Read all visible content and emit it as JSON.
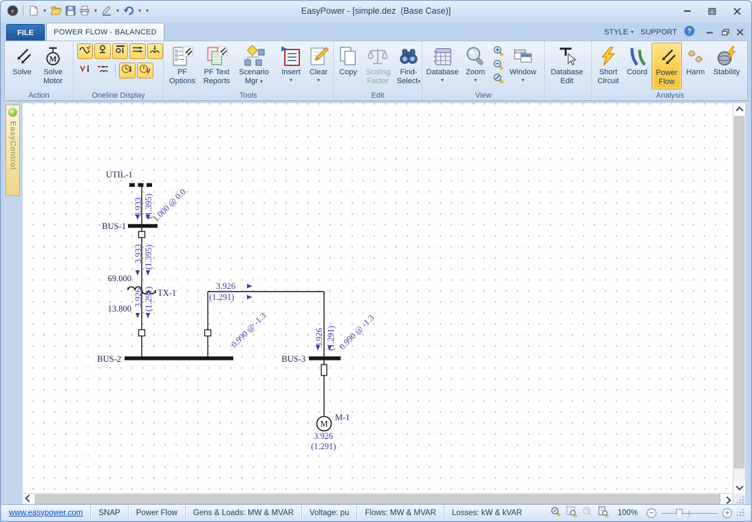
{
  "window": {
    "title": "EasyPower - [simple.dez  (Base Case)]",
    "style_menu": "STYLE",
    "support_menu": "SUPPORT"
  },
  "tabs": {
    "file": "FILE",
    "power_flow_balanced": "POWER FLOW - BALANCED"
  },
  "ribbon": {
    "action": {
      "label": "Action",
      "solve": "Solve",
      "solve_motor": "Solve Motor"
    },
    "oneline_display": {
      "label": "Oneline Display"
    },
    "tools": {
      "label": "Tools",
      "pf_options": "PF Options",
      "pf_text_reports": "PF Text Reports",
      "scenario_mgr": "Scenario Mgr",
      "insert": "Insert",
      "clear": "Clear"
    },
    "edit": {
      "label": "Edit",
      "copy": "Copy",
      "scaling_factor": "Scaling Factor",
      "find_select": "Find-Select"
    },
    "view": {
      "label": "View",
      "database": "Database",
      "zoom": "Zoom",
      "window": "Window"
    },
    "database_edit": {
      "label": "Database Edit"
    },
    "analysis": {
      "label": "Analysis",
      "short_circuit": "Short Circuit",
      "coord": "Coord",
      "power_flow": "Power Flow",
      "harm": "Harm",
      "stability": "Stability"
    }
  },
  "easycontrol": {
    "label": "EasyControl"
  },
  "diagram": {
    "util1": {
      "label": "UTIL-1",
      "mw": "3.933",
      "mvar": "(1.395)",
      "voltage": "1.000 @ 0.0"
    },
    "bus1": {
      "label": "BUS-1"
    },
    "tx1": {
      "label": "TX-1",
      "primary_kv": "69.000",
      "secondary_kv": "13.800",
      "in_mw": "3.933",
      "in_mvar": "(1.395)",
      "out_mw": "3.926",
      "out_mvar": "(1.291)"
    },
    "bus2": {
      "label": "BUS-2",
      "voltage": "0.990 @ -1.3"
    },
    "feeder": {
      "mw": "3.926",
      "mvar": "(1.291)"
    },
    "bus3": {
      "label": "BUS-3",
      "voltage": "0.990 @ -1.3",
      "mw": "3.926",
      "mvar": "(1.291)"
    },
    "m1": {
      "label": "M-1",
      "mw": "3.926",
      "mvar": "(1.291)"
    }
  },
  "statusbar": {
    "website_link": "www.easypower.com",
    "snap": "SNAP",
    "mode": "Power Flow",
    "gens_loads_units": "Gens & Loads: MW & MVAR",
    "voltage_units": "Voltage: pu",
    "flow_units": "Flows: MW & MVAR",
    "loss_units": "Losses: kW & kVAR",
    "zoom_percent": "100%"
  }
}
